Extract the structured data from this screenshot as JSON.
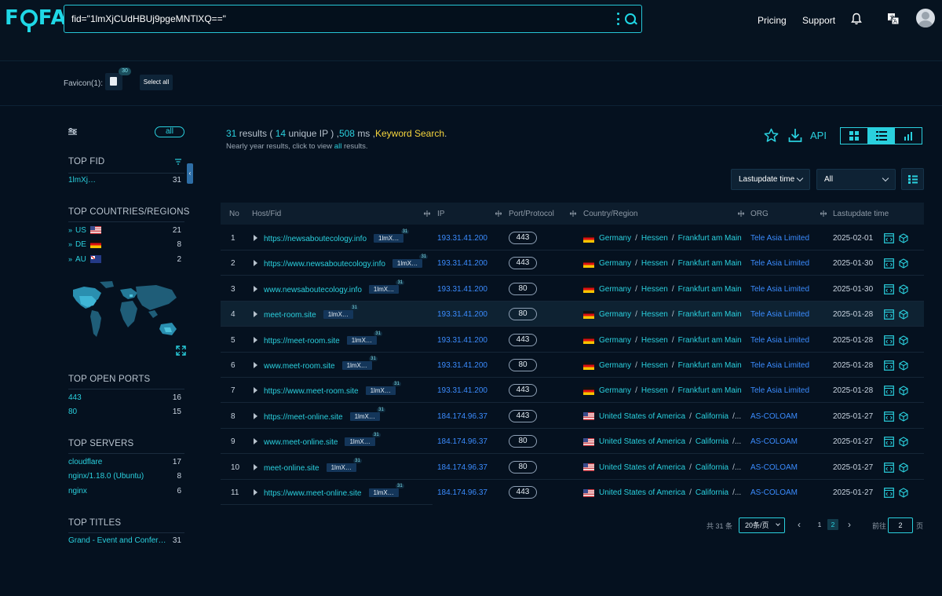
{
  "header": {
    "logo": "FOFA",
    "query": "fid=\"1lmXjCUdHBUj9pgeMNTlXQ==\"",
    "nav": {
      "pricing": "Pricing",
      "support": "Support"
    },
    "icons": {
      "more": "more-vertical-icon",
      "search": "search-icon",
      "bell": "bell-icon",
      "lang": "translate-icon",
      "avatar": "user-avatar"
    }
  },
  "favicon_bar": {
    "label": "Favicon(1):",
    "count": "30",
    "select_all": "Select all"
  },
  "sidebar": {
    "all_label": "all",
    "top_fid": {
      "title": "TOP FID",
      "items": [
        {
          "key": "1lmXj…",
          "value": "31"
        }
      ]
    },
    "top_countries": {
      "title": "TOP COUNTRIES/REGIONS",
      "items": [
        {
          "key": "US",
          "flag": "us",
          "value": "21"
        },
        {
          "key": "DE",
          "flag": "de",
          "value": "8"
        },
        {
          "key": "AU",
          "flag": "au",
          "value": "2"
        }
      ]
    },
    "top_ports": {
      "title": "TOP OPEN PORTS",
      "items": [
        {
          "key": "443",
          "value": "16"
        },
        {
          "key": "80",
          "value": "15"
        }
      ]
    },
    "top_servers": {
      "title": "TOP SERVERS",
      "items": [
        {
          "key": "cloudflare",
          "value": "17"
        },
        {
          "key": "nginx/1.18.0 (Ubuntu)",
          "value": "8"
        },
        {
          "key": "nginx",
          "value": "6"
        }
      ]
    },
    "top_titles": {
      "title": "TOP TITLES",
      "items": [
        {
          "key": "Grand - Event and Conferen…",
          "value": "31"
        }
      ]
    }
  },
  "summary": {
    "results": "31",
    "results_label": "results (",
    "unique_ip": "14",
    "unique_ip_label": "unique IP ) ,",
    "ms": "508",
    "ms_label": "ms ,",
    "keyword": "Keyword Search",
    "end": ".",
    "sub_pre": "Nearly year results, click to view",
    "sub_link": "all",
    "sub_post": "results."
  },
  "toolbar": {
    "api": "API",
    "sort_label": "Lastupdate time",
    "filter_label": "All",
    "view_modes": [
      "grid-view-icon",
      "list-view-icon",
      "stats-view-icon"
    ],
    "active_view": 1
  },
  "table": {
    "headers": {
      "no": "No",
      "host": "Host/Fid",
      "ip": "IP",
      "port": "Port/Protocol",
      "country": "Country/Region",
      "org": "ORG",
      "date": "Lastupdate time"
    },
    "rows": [
      {
        "no": "1",
        "host": "https://newsaboutecology.info",
        "fid": "1lmX…",
        "fid_count": "31",
        "ip": "193.31.41.200",
        "port": "443",
        "flag": "de",
        "country": "Germany",
        "region": "Hessen",
        "city": "Frankfurt am Main",
        "org": "Tele Asia Limited",
        "date": "2025-02-01"
      },
      {
        "no": "2",
        "host": "https://www.newsaboutecology.info",
        "fid": "1lmX…",
        "fid_count": "31",
        "ip": "193.31.41.200",
        "port": "443",
        "flag": "de",
        "country": "Germany",
        "region": "Hessen",
        "city": "Frankfurt am Main",
        "org": "Tele Asia Limited",
        "date": "2025-01-30"
      },
      {
        "no": "3",
        "host": "www.newsaboutecology.info",
        "fid": "1lmX…",
        "fid_count": "31",
        "ip": "193.31.41.200",
        "port": "80",
        "flag": "de",
        "country": "Germany",
        "region": "Hessen",
        "city": "Frankfurt am Main",
        "org": "Tele Asia Limited",
        "date": "2025-01-30"
      },
      {
        "no": "4",
        "host": "meet-room.site",
        "fid": "1lmX…",
        "fid_count": "31",
        "ip": "193.31.41.200",
        "port": "80",
        "flag": "de",
        "country": "Germany",
        "region": "Hessen",
        "city": "Frankfurt am Main",
        "org": "Tele Asia Limited",
        "date": "2025-01-28"
      },
      {
        "no": "5",
        "host": "https://meet-room.site",
        "fid": "1lmX…",
        "fid_count": "31",
        "ip": "193.31.41.200",
        "port": "443",
        "flag": "de",
        "country": "Germany",
        "region": "Hessen",
        "city": "Frankfurt am Main",
        "org": "Tele Asia Limited",
        "date": "2025-01-28"
      },
      {
        "no": "6",
        "host": "www.meet-room.site",
        "fid": "1lmX…",
        "fid_count": "31",
        "ip": "193.31.41.200",
        "port": "80",
        "flag": "de",
        "country": "Germany",
        "region": "Hessen",
        "city": "Frankfurt am Main",
        "org": "Tele Asia Limited",
        "date": "2025-01-28"
      },
      {
        "no": "7",
        "host": "https://www.meet-room.site",
        "fid": "1lmX…",
        "fid_count": "31",
        "ip": "193.31.41.200",
        "port": "443",
        "flag": "de",
        "country": "Germany",
        "region": "Hessen",
        "city": "Frankfurt am Main",
        "org": "Tele Asia Limited",
        "date": "2025-01-28"
      },
      {
        "no": "8",
        "host": "https://meet-online.site",
        "fid": "1lmX…",
        "fid_count": "31",
        "ip": "184.174.96.37",
        "port": "443",
        "flag": "us",
        "country": "United States of America",
        "region": "California",
        "city": "/...",
        "org": "AS-COLOAM",
        "date": "2025-01-27"
      },
      {
        "no": "9",
        "host": "www.meet-online.site",
        "fid": "1lmX…",
        "fid_count": "31",
        "ip": "184.174.96.37",
        "port": "80",
        "flag": "us",
        "country": "United States of America",
        "region": "California",
        "city": "/...",
        "org": "AS-COLOAM",
        "date": "2025-01-27"
      },
      {
        "no": "10",
        "host": "meet-online.site",
        "fid": "1lmX…",
        "fid_count": "31",
        "ip": "184.174.96.37",
        "port": "80",
        "flag": "us",
        "country": "United States of America",
        "region": "California",
        "city": "/...",
        "org": "AS-COLOAM",
        "date": "2025-01-27"
      },
      {
        "no": "11",
        "host": "https://www.meet-online.site",
        "fid": "1lmX…",
        "fid_count": "31",
        "ip": "184.174.96.37",
        "port": "443",
        "flag": "us",
        "country": "United States of America",
        "region": "California",
        "city": "/...",
        "org": "AS-COLOAM",
        "date": "2025-01-27"
      }
    ],
    "highlighted_row": 4
  },
  "pagination": {
    "total": "共 31 条",
    "page_size": "20条/页",
    "prev": "‹",
    "next": "›",
    "pages": [
      "1",
      "2"
    ],
    "current": "2",
    "goto_label": "前往",
    "goto_value": "2",
    "goto_unit": "页"
  },
  "colors": {
    "accent": "#2ad0de",
    "link": "#3b8cff",
    "keyword": "#f6d53d",
    "background": "#05111f"
  }
}
